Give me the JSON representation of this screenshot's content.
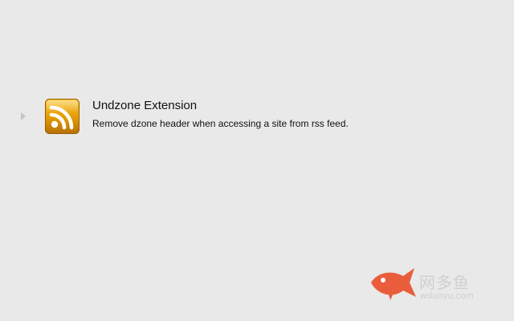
{
  "extension": {
    "name": "Undzone Extension",
    "description": "Remove dzone header when accessing a site from rss feed.",
    "icon": "rss-feed-icon",
    "icon_color": "#e8a200"
  },
  "watermark": {
    "brand_cn": "网多鱼",
    "url": "wduoyu.com",
    "logo_icon": "fish-icon",
    "logo_color": "#ea5d3c"
  }
}
